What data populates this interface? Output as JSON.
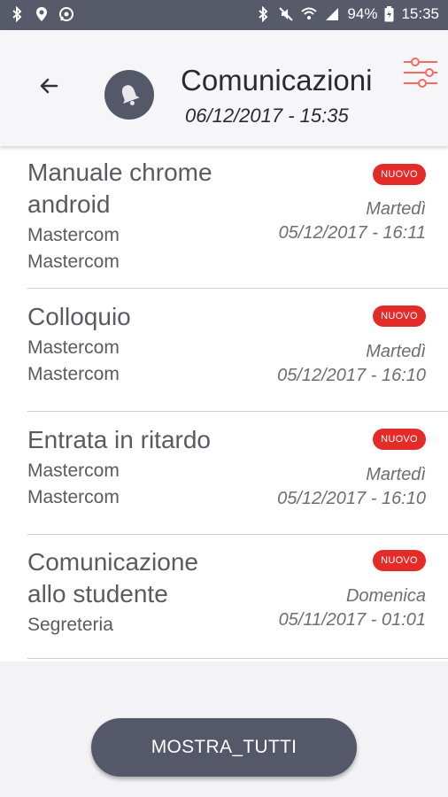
{
  "status_bar": {
    "battery": "94%",
    "time": "15:35",
    "left_icons": [
      "bluetooth-notification-icon",
      "location-icon",
      "whatsapp-icon"
    ],
    "right_icons": [
      "bluetooth-icon",
      "mute-icon",
      "wifi-icon",
      "signal-icon",
      "battery-icon"
    ]
  },
  "header": {
    "title": "Comunicazioni",
    "subtitle": "06/12/2017 - 15:35",
    "avatar_icon": "bell-icon",
    "filter_icon": "sliders-icon"
  },
  "messages": [
    {
      "title_lines": [
        "Manuale chrome",
        "android"
      ],
      "sub_lines": [
        "Mastercom",
        "Mastercom"
      ],
      "badge": "NUOVO",
      "day": "Martedì",
      "datetime": "05/12/2017 - 16:11"
    },
    {
      "title_lines": [
        "Colloquio"
      ],
      "sub_lines": [
        "Mastercom",
        "Mastercom"
      ],
      "badge": "NUOVO",
      "day": "Martedì",
      "datetime": "05/12/2017 - 16:10"
    },
    {
      "title_lines": [
        "Entrata in ritardo"
      ],
      "sub_lines": [
        "Mastercom",
        "Mastercom"
      ],
      "badge": "NUOVO",
      "day": "Martedì",
      "datetime": "05/12/2017 - 16:10"
    },
    {
      "title_lines": [
        "Comunicazione",
        "allo studente"
      ],
      "sub_lines": [
        "Segreteria"
      ],
      "badge": "NUOVO",
      "day": "Domenica",
      "datetime": "05/11/2017 - 01:01"
    }
  ],
  "footer": {
    "show_all_label": "MOSTRA_TUTTI"
  },
  "colors": {
    "accent": "#e52b27",
    "primary": "#545868",
    "filter_icon": "#f26b62"
  }
}
